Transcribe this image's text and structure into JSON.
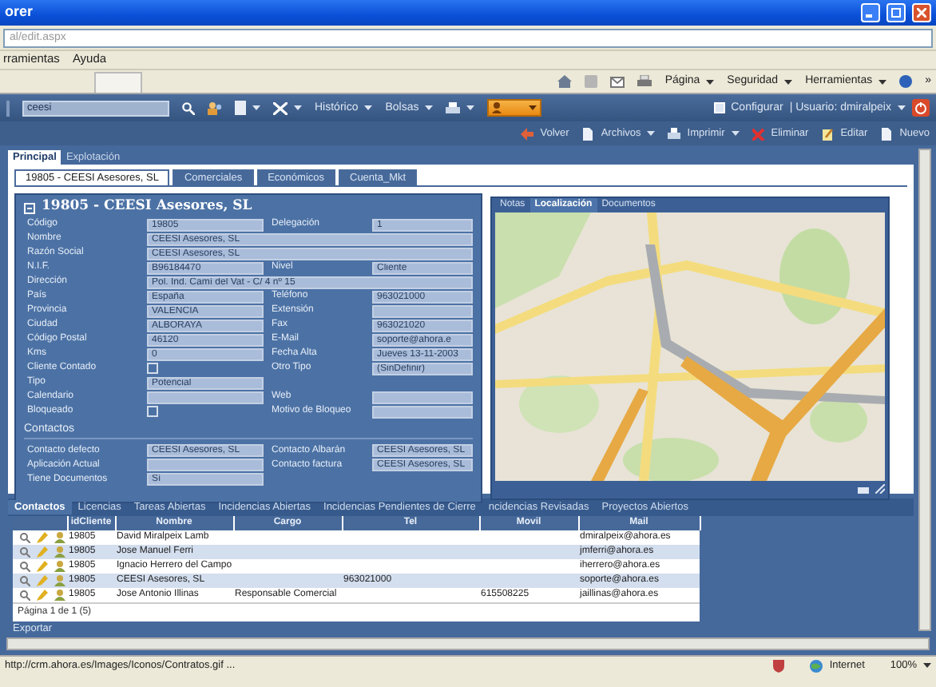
{
  "window": {
    "title": "orer",
    "address": "al/edit.aspx"
  },
  "menu": [
    "rramientas",
    "Ayuda"
  ],
  "ie_toolbar": {
    "menus": [
      "Página",
      "Seguridad",
      "Herramientas"
    ],
    "more": "»"
  },
  "app_toolbar": {
    "search": "ceesi",
    "menus": [
      "Histórico",
      "Bolsas"
    ],
    "configure": {
      "label": "Configurar",
      "checked": false
    },
    "user": "| Usuario: dmiralpeix"
  },
  "actions": [
    {
      "label": "Volver",
      "kind": "back",
      "dropdown": false
    },
    {
      "label": "Archivos",
      "kind": "document",
      "dropdown": true
    },
    {
      "label": "Imprimir",
      "kind": "printer",
      "dropdown": true
    },
    {
      "label": "Eliminar",
      "kind": "delete",
      "dropdown": false
    },
    {
      "label": "Editar",
      "kind": "pencil",
      "dropdown": false
    },
    {
      "label": "Nuevo",
      "kind": "document",
      "dropdown": false
    }
  ],
  "main_tabs": [
    {
      "label": "Principal",
      "selected": true
    },
    {
      "label": "Explotación",
      "selected": false
    }
  ],
  "record_tabs": [
    {
      "label": "19805 - CEESI Asesores, SL",
      "selected": true
    },
    {
      "label": "Comerciales",
      "selected": false
    },
    {
      "label": "Económicos",
      "selected": false
    },
    {
      "label": "Cuenta_Mkt",
      "selected": false
    }
  ],
  "record": {
    "title": "19805 - CEESI Asesores, SL",
    "rows": [
      {
        "fields": [
          {
            "kind": "text",
            "label": "Código",
            "value": "19805"
          },
          {
            "kind": "text",
            "label": "Delegación",
            "value": "1"
          }
        ]
      },
      {
        "fields": [
          {
            "kind": "text",
            "label": "Nombre",
            "value": "CEESI Asesores, SL",
            "wide": true
          }
        ]
      },
      {
        "fields": [
          {
            "kind": "text",
            "label": "Razón Social",
            "value": "CEESI Asesores, SL",
            "wide": true
          }
        ]
      },
      {
        "fields": [
          {
            "kind": "text",
            "label": "N.I.F.",
            "value": "B96184470"
          },
          {
            "kind": "text",
            "label": "Nivel",
            "value": "Cliente"
          }
        ]
      },
      {
        "fields": [
          {
            "kind": "text",
            "label": "Dirección",
            "value": "Pol. Ind. Camí del Vat - C/ 4 nº 15",
            "wide": true
          }
        ]
      },
      {
        "fields": [
          {
            "kind": "text",
            "label": "País",
            "value": "España"
          },
          {
            "kind": "text",
            "label": "Teléfono",
            "value": "963021000"
          }
        ]
      },
      {
        "fields": [
          {
            "kind": "text",
            "label": "Provincia",
            "value": "VALENCIA"
          },
          {
            "kind": "text",
            "label": "Extensión"
          }
        ]
      },
      {
        "fields": [
          {
            "kind": "text",
            "label": "Ciudad",
            "value": "ALBORAYA"
          },
          {
            "kind": "text",
            "label": "Fax",
            "value": "963021020"
          }
        ]
      },
      {
        "fields": [
          {
            "kind": "text",
            "label": "Código Postal",
            "value": "46120"
          },
          {
            "kind": "text",
            "label": "E-Mail",
            "value": "soporte@ahora.e"
          }
        ]
      },
      {
        "fields": [
          {
            "kind": "text",
            "label": "Kms",
            "value": "0"
          },
          {
            "kind": "text",
            "label": "Fecha Alta",
            "value": "Jueves 13-11-2003"
          }
        ]
      },
      {
        "fields": [
          {
            "kind": "check",
            "label": "Cliente Contado",
            "checked": false
          },
          {
            "kind": "text",
            "label": "Otro Tipo",
            "value": "(SinDefinir)"
          }
        ]
      },
      {
        "fields": [
          {
            "kind": "text",
            "label": "Tipo",
            "value": "Potencial"
          }
        ]
      },
      {
        "fields": [
          {
            "kind": "text",
            "label": "Calendario"
          },
          {
            "kind": "text",
            "label": "Web"
          }
        ]
      },
      {
        "fields": [
          {
            "kind": "check",
            "label": "Bloqueado",
            "checked": false
          },
          {
            "kind": "text",
            "label": "Motivo de Bloqueo"
          }
        ]
      }
    ],
    "contacts_title": "Contactos",
    "contact_rows": [
      {
        "fields": [
          {
            "kind": "text",
            "label": "Contacto defecto",
            "value": "CEESI Asesores, SL"
          },
          {
            "kind": "text",
            "label": "Contacto Albarán",
            "value": "CEESI Asesores, SL"
          }
        ]
      },
      {
        "fields": [
          {
            "kind": "text",
            "label": "Aplicación Actual"
          },
          {
            "kind": "text",
            "label": "Contacto factura",
            "value": "CEESI Asesores, SL"
          }
        ]
      },
      {
        "fields": [
          {
            "kind": "text",
            "label": "Tiene Documentos",
            "value": "Sí"
          }
        ]
      }
    ]
  },
  "side_tabs": [
    {
      "label": "Notas",
      "selected": false
    },
    {
      "label": "Localización",
      "selected": true
    },
    {
      "label": "Documentos",
      "selected": false
    }
  ],
  "bottom_tabs": [
    {
      "label": "Contactos",
      "selected": true
    },
    {
      "label": "Licencias",
      "selected": false
    },
    {
      "label": "Tareas Abiertas",
      "selected": false
    },
    {
      "label": "Incidencias Abiertas",
      "selected": false
    },
    {
      "label": "Incidencias Pendientes de Cierre",
      "selected": false
    },
    {
      "label": "ncidencias Revisadas",
      "selected": false
    },
    {
      "label": "Proyectos Abiertos",
      "selected": false
    }
  ],
  "contacts_table": {
    "columns": [
      "idCliente",
      "Nombre",
      "Cargo",
      "Tel",
      "Movil",
      "Mail"
    ],
    "rows": [
      {
        "id": "19805",
        "name": "David Miralpeix Lamb",
        "mail": "dmiralpeix@ahora.es"
      },
      {
        "id": "19805",
        "name": "Jose Manuel Ferri",
        "mail": "jmferri@ahora.es"
      },
      {
        "id": "19805",
        "name": "Ignacio Herrero del Campo",
        "mail": "iherrero@ahora.es"
      },
      {
        "id": "19805",
        "name": "CEESI Asesores, SL",
        "tel": "963021000",
        "mail": "soporte@ahora.es"
      },
      {
        "id": "19805",
        "name": "Jose Antonio Illinas",
        "role": "Responsable Comercial",
        "mobile": "615508225",
        "mail": "jaillinas@ahora.es"
      }
    ],
    "pager": "Página 1 de 1 (5)"
  },
  "export": "Exportar",
  "status_bar": {
    "url": "http://crm.ahora.es/Images/Iconos/Contratos.gif ...",
    "zone": "Internet",
    "zoom": "100%"
  }
}
